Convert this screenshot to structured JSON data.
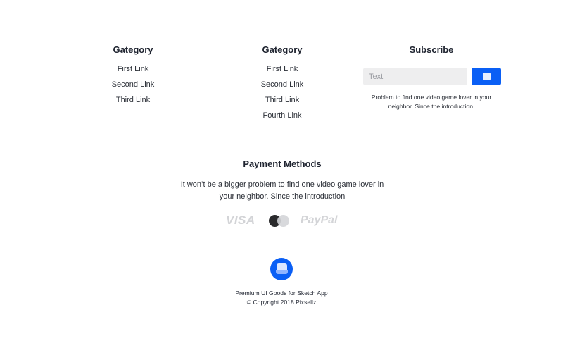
{
  "columns": [
    {
      "heading": "Gategory",
      "links": [
        "First Link",
        "Second Link",
        "Third Link"
      ]
    },
    {
      "heading": "Gategory",
      "links": [
        "First Link",
        "Second Link",
        "Third Link",
        "Fourth Link"
      ]
    }
  ],
  "subscribe": {
    "heading": "Subscribe",
    "input_placeholder": "Text",
    "description": "Problem to find one video game lover in your neighbor. Since the introduction.",
    "button_color": "#0a5ff5"
  },
  "payment": {
    "heading": "Payment Methods",
    "description": "It won’t be a bigger problem to find one video game lover in your neighbor. Since the introduction",
    "methods": {
      "visa": "VISA",
      "mastercard_icon": "mastercard-icon",
      "paypal": "PayPal"
    }
  },
  "footer": {
    "logo_icon": "layers-icon",
    "line1": "Premium UI Goods for Sketch App",
    "line2": "© Copyright 2018 Pixsellz"
  },
  "colors": {
    "accent": "#0a5ff5",
    "muted_logo": "#d3d4d7"
  }
}
